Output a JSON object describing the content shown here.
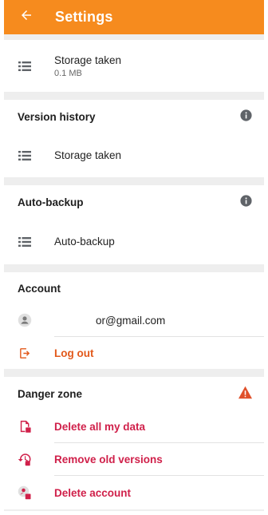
{
  "appbar": {
    "title": "Settings",
    "color": "#f68b1e",
    "back_icon": "arrow-left-icon"
  },
  "storage": {
    "label": "Storage taken",
    "value": "0.1 MB",
    "icon": "list-icon"
  },
  "version_history": {
    "header": "Version history",
    "info_icon": "info-icon",
    "item_label": "Storage taken",
    "item_icon": "list-icon"
  },
  "auto_backup": {
    "header": "Auto-backup",
    "info_icon": "info-icon",
    "item_label": "Auto-backup",
    "item_icon": "list-icon"
  },
  "account": {
    "header": "Account",
    "email": "or@gmail.com",
    "avatar_icon": "person-icon",
    "logout_label": "Log out",
    "logout_icon": "logout-icon",
    "logout_color": "#e2591b"
  },
  "danger_zone": {
    "header": "Danger zone",
    "warning_icon": "warning-icon",
    "warning_color": "#e0502a",
    "item_color": "#d0204a",
    "items": [
      {
        "label": "Delete all my data",
        "icon": "delete-data-icon"
      },
      {
        "label": "Remove old versions",
        "icon": "remove-versions-icon"
      },
      {
        "label": "Delete account",
        "icon": "delete-account-icon"
      }
    ]
  }
}
